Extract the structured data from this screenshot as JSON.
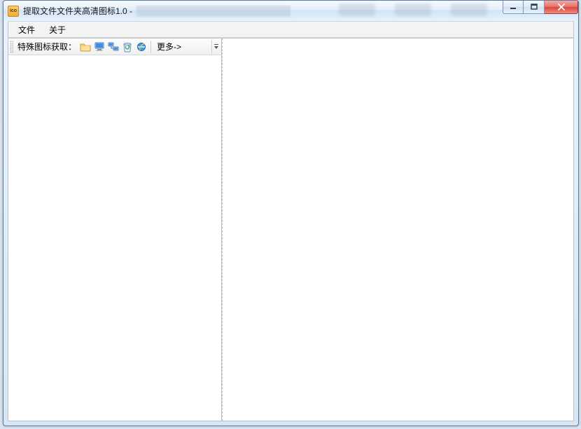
{
  "window": {
    "title": "提取文件文件夹高清图标1.0 -"
  },
  "menubar": {
    "file": "文件",
    "about": "关于"
  },
  "toolbar": {
    "label": "特殊图标获取：",
    "more": "更多->",
    "icons": {
      "folder": "folder-icon",
      "computer": "computer-icon",
      "network": "network-icon",
      "recycle": "recycle-bin-icon",
      "ie": "internet-explorer-icon"
    }
  }
}
